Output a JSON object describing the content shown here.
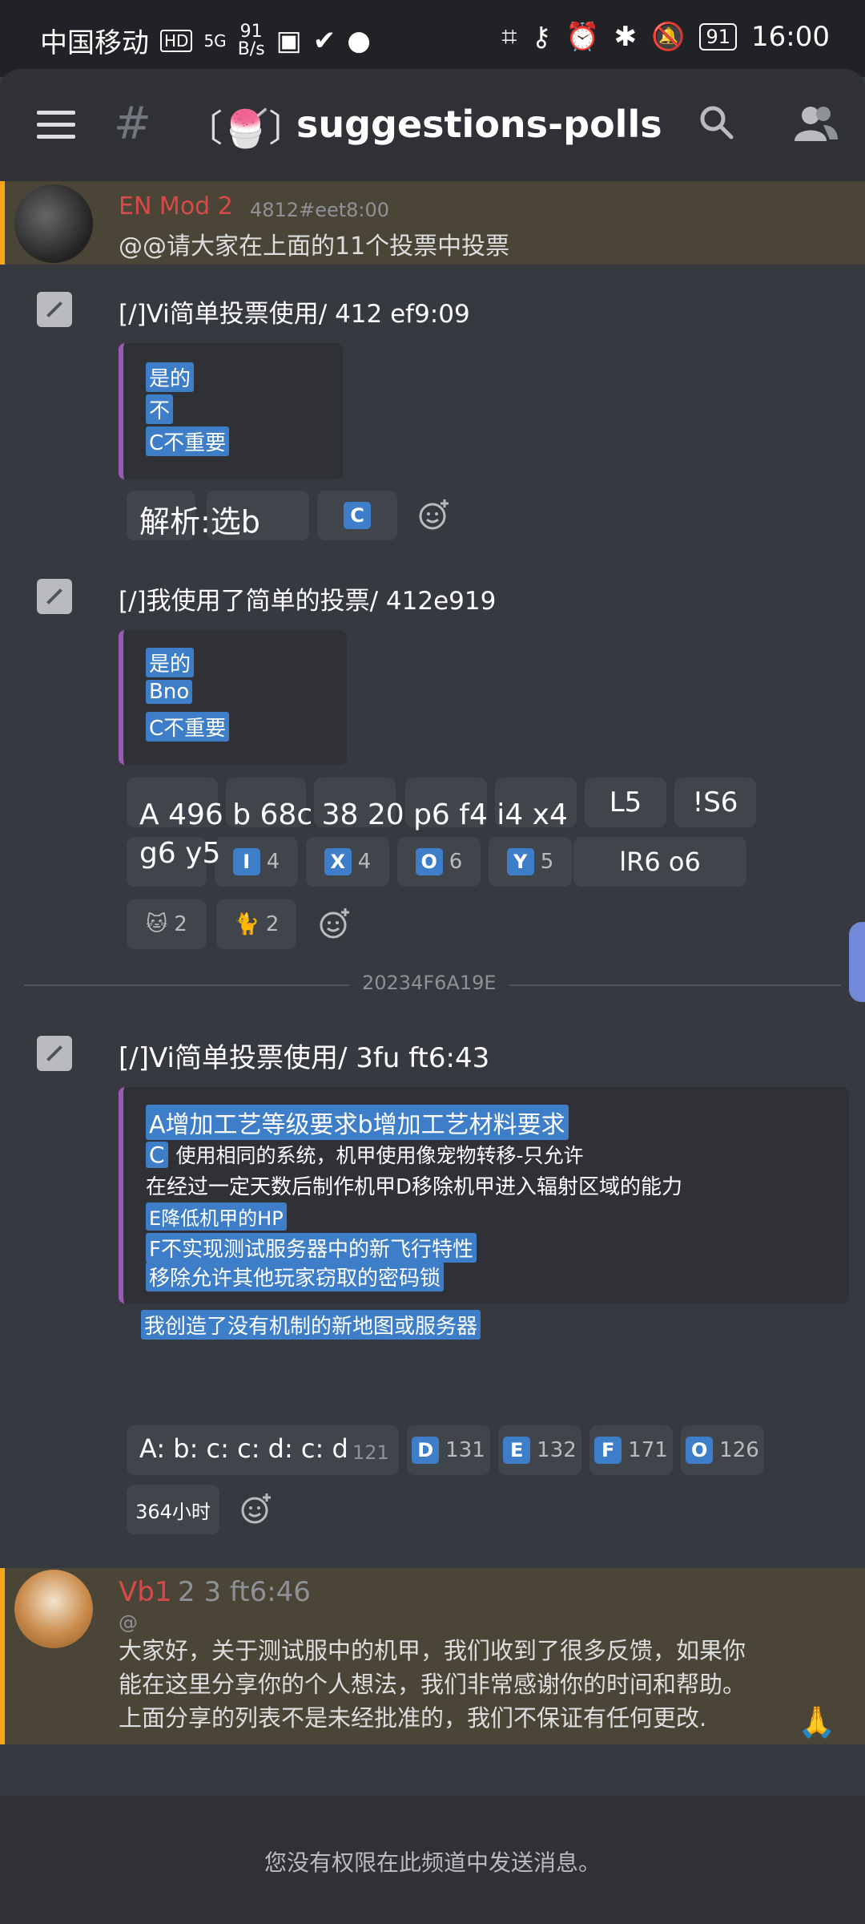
{
  "status_bar": {
    "carrier": "中国移动",
    "hd": "HD",
    "signal": "5G",
    "net_speed_value": "91",
    "net_speed_unit": "B/s",
    "battery": "91",
    "time": "16:00"
  },
  "header": {
    "menu_icon": "hamburger-icon",
    "channel_prefix": "#",
    "channel_emoji": "〔🍧〕",
    "channel_name": "suggestions-polls",
    "search_icon": "search-icon",
    "members_icon": "members-icon"
  },
  "messages": [
    {
      "username": "EN Mod 2",
      "meta": "4812#eet8:00",
      "text": "@@请大家在上面的11个投票中投票"
    },
    {
      "command": "[/]Vi简单投票使用/ 412 ef9:09",
      "options": [
        "是的",
        "不",
        "C不重要"
      ],
      "reaction_text": "解析:选b"
    },
    {
      "command": "[/]我使用了简单的投票/ 412e919",
      "options": [
        "是的",
        "Bno",
        "C不重要"
      ],
      "reaction_text_1": "A 496 b 68c 38 20 p6 f4 i4 x4",
      "reaction_text_2": "g6 y5",
      "reaction_L": "L5",
      "reaction_S": "!S6",
      "reaction_R": "lR6 o6",
      "emoji_reactions": [
        {
          "emoji": "🐱",
          "count": "2"
        },
        {
          "emoji": "🐈",
          "count": "2"
        }
      ]
    },
    {
      "divider": "20234F6A19E",
      "command": "[/]Vi简单投票使用/ 3fu ft6:43",
      "options": [
        "A增加工艺等级要求b增加工艺材料要求",
        "使用相同的系统，机甲使用像宠物转移-只允许",
        "在经过一定天数后制作机甲D移除机甲进入辐射区域的能力",
        "E降低机甲的HP",
        "F不实现测试服务器中的新飞行特性",
        "移除允许其他玩家窃取的密码锁",
        "我创造了没有机制的新地图或服务器"
      ],
      "option_tag_c": "C",
      "reaction_text": "A: b: c: c: d: c: d",
      "reaction_values": [
        "121",
        "131",
        "132",
        "171",
        "126"
      ],
      "hours": "364小时"
    },
    {
      "username": "Vb1",
      "meta": "2 3 ft6:46",
      "mention": "@",
      "text_lines": [
        "大家好，关于测试服中的机甲，我们收到了很多反馈，如果你",
        "能在这里分享你的个人想法，我们非常感谢你的时间和帮助。",
        "上面分享的列表不是未经批准的，我们不保证有任何更改."
      ],
      "pray_emoji": "🙏"
    }
  ],
  "footer": {
    "no_permission": "您没有权限在此频道中发送消息。"
  },
  "colors": {
    "background": "#36393f",
    "header": "#2f3136",
    "highlight": "#4a4536",
    "accent_bar": "#faa61a",
    "mod_name": "#d84a4a",
    "reaction_tag": "#3e7ec9"
  }
}
